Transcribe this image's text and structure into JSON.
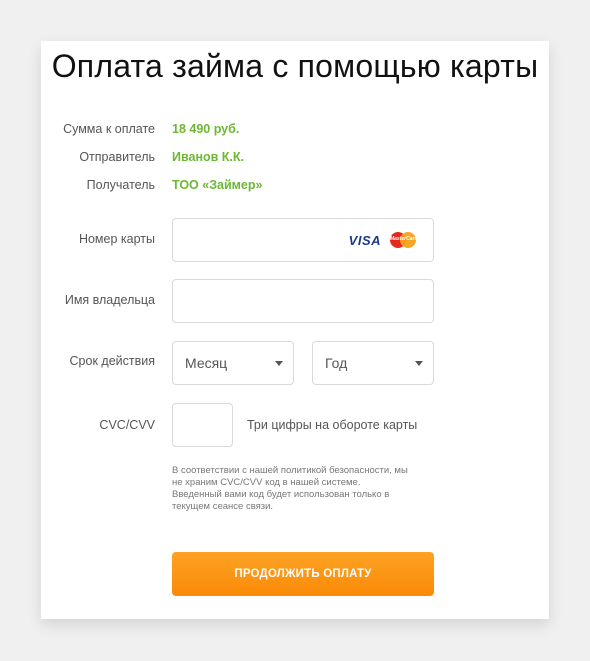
{
  "title": "Оплата займа с помощью карты",
  "summary": {
    "amount_label": "Сумма к оплате",
    "amount_value": "18 490 руб.",
    "sender_label": "Отправитель",
    "sender_value": "Иванов К.К.",
    "recipient_label": "Получатель",
    "recipient_value": "ТОО «Займер»"
  },
  "form": {
    "card_number_label": "Номер карты",
    "card_number_value": "",
    "visa_logo": "VISA",
    "mastercard_logo": "MasterCard",
    "holder_label": "Имя владельца",
    "holder_value": "",
    "expiry_label": "Срок действия",
    "month_select": "Месяц",
    "year_select": "Год",
    "cvc_label": "CVC/CVV",
    "cvc_value": "",
    "cvc_hint": "Три цифры на обороте карты",
    "security_note": "В соответствии с нашей политикой безопасности, мы не храним CVC/CVV код в нашей системе. Введенный вами код будет использован только в текущем сеансе связи.",
    "submit_label": "ПРОДОЛЖИТЬ ОПЛАТУ"
  },
  "colors": {
    "accent_green": "#6cb733",
    "button_orange": "#fb8a08"
  },
  "icons": [
    "visa-logo-icon",
    "mastercard-logo-icon",
    "chevron-down-icon"
  ]
}
